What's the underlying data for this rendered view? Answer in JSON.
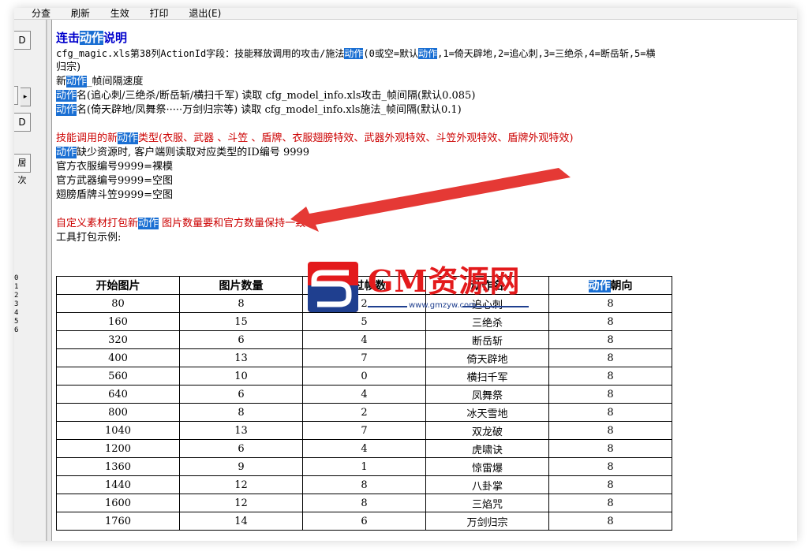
{
  "menubar": [
    "分查",
    "刷新",
    "生效",
    "打印",
    "退出(E)"
  ],
  "left_panel": {
    "buttons": [
      "D",
      "▸",
      "D",
      "居次"
    ],
    "row_numbers": [
      "0",
      "1",
      "2",
      "3",
      "4",
      "5",
      "6"
    ]
  },
  "doc": {
    "title": {
      "pre": "连击",
      "hl": "动作",
      "post": "说明"
    },
    "line1": {
      "pre": "cfg_magic.xls第38列ActionId字段：技能释放调用的攻击/施法",
      "hl1": "动作",
      "mid": "(0或空=默认",
      "hl2": "动作",
      "post": ",1=倚天辟地,2=追心刺,3=三绝杀,4=断岳斩,5=横"
    },
    "line2": "归宗)",
    "line3": {
      "pre": "新",
      "hl": "动作",
      "post": "_帧间隔速度"
    },
    "line4": {
      "hl": "动作",
      "post": "名(追心刺/三绝杀/断岳斩/横扫千军)  读取   cfg_model_info.xls攻击_帧间隔(默认0.085)"
    },
    "line5": {
      "hl": "动作",
      "post": "名(倚天辟地/凤舞祭·····万剑归宗等)  读取   cfg_model_info.xls施法_帧间隔(默认0.1)"
    },
    "line6": {
      "pre": "技能调用的新",
      "hl": "动作",
      "post": "类型(衣服、武器 、斗笠 、盾牌、衣服翅膀特效、武器外观特效、斗笠外观特效、盾牌外观特效)"
    },
    "line7": {
      "hl": "动作",
      "post": "缺少资源时, 客户端则读取对应类型的ID编号 9999"
    },
    "line8": "官方衣服编号9999=裸模",
    "line9": "官方武器编号9999=空图",
    "line10": "翅膀盾牌斗笠9999=空图",
    "line11": {
      "pre": "自定义素材打包新",
      "hl": "动作",
      "post": " 图片数量要和官方数量保持一致"
    },
    "line12": "工具打包示例:"
  },
  "table": {
    "headers": [
      "开始图片",
      "图片数量",
      "跳过帧数",
      "动作名",
      "动作朝向"
    ],
    "header_hl_last": "动作",
    "header_last_post": "朝向",
    "rows": [
      [
        "80",
        "8",
        "2",
        "追心刺",
        "8"
      ],
      [
        "160",
        "15",
        "5",
        "三绝杀",
        "8"
      ],
      [
        "320",
        "6",
        "4",
        "断岳斩",
        "8"
      ],
      [
        "400",
        "13",
        "7",
        "倚天辟地",
        "8"
      ],
      [
        "560",
        "10",
        "0",
        "横扫千军",
        "8"
      ],
      [
        "640",
        "6",
        "4",
        "凤舞祭",
        "8"
      ],
      [
        "800",
        "8",
        "2",
        "冰天雪地",
        "8"
      ],
      [
        "1040",
        "13",
        "7",
        "双龙破",
        "8"
      ],
      [
        "1200",
        "6",
        "4",
        "虎啸诀",
        "8"
      ],
      [
        "1360",
        "9",
        "1",
        "惊雷爆",
        "8"
      ],
      [
        "1440",
        "12",
        "8",
        "八卦掌",
        "8"
      ],
      [
        "1600",
        "12",
        "8",
        "三焰咒",
        "8"
      ],
      [
        "1760",
        "14",
        "6",
        "万剑归宗",
        "8"
      ]
    ]
  },
  "watermark": {
    "text": "GM资源网",
    "url": "www.gmzyw.com"
  },
  "colors": {
    "highlight": "#1a6fd3",
    "title": "#0000cc",
    "red_text": "#cc0000",
    "arrow": "#e53935"
  }
}
